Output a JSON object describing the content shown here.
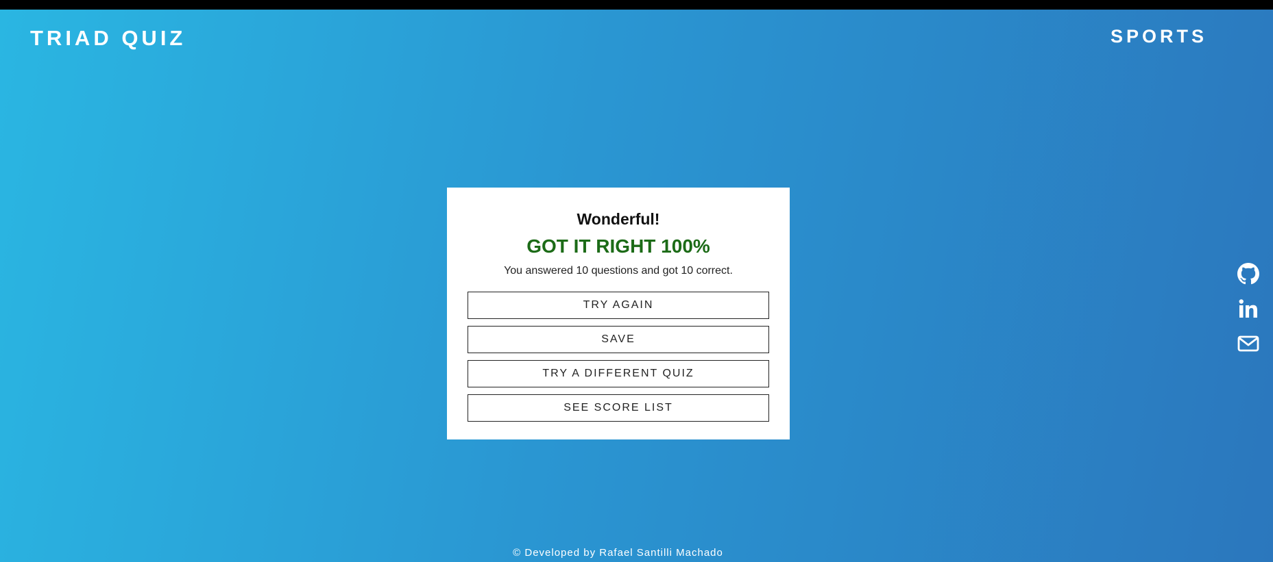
{
  "header": {
    "brand": "TRIAD QUIZ",
    "category": "SPORTS"
  },
  "result_card": {
    "title": "Wonderful!",
    "result": "GOT IT RIGHT 100%",
    "summary": "You answered 10 questions and got 10 correct.",
    "buttons": {
      "try_again": "TRY AGAIN",
      "save": "SAVE",
      "different_quiz": "TRY A DIFFERENT QUIZ",
      "score_list": "SEE SCORE LIST"
    }
  },
  "social": {
    "icons": [
      "github-icon",
      "linkedin-icon",
      "mail-icon"
    ]
  },
  "footer": {
    "credit": "© Developed by Rafael Santilli Machado"
  },
  "colors": {
    "gradient_start": "#2ab6e2",
    "gradient_end": "#2b77bd",
    "result_green": "#1c6b17",
    "top_bar": "#000000"
  }
}
